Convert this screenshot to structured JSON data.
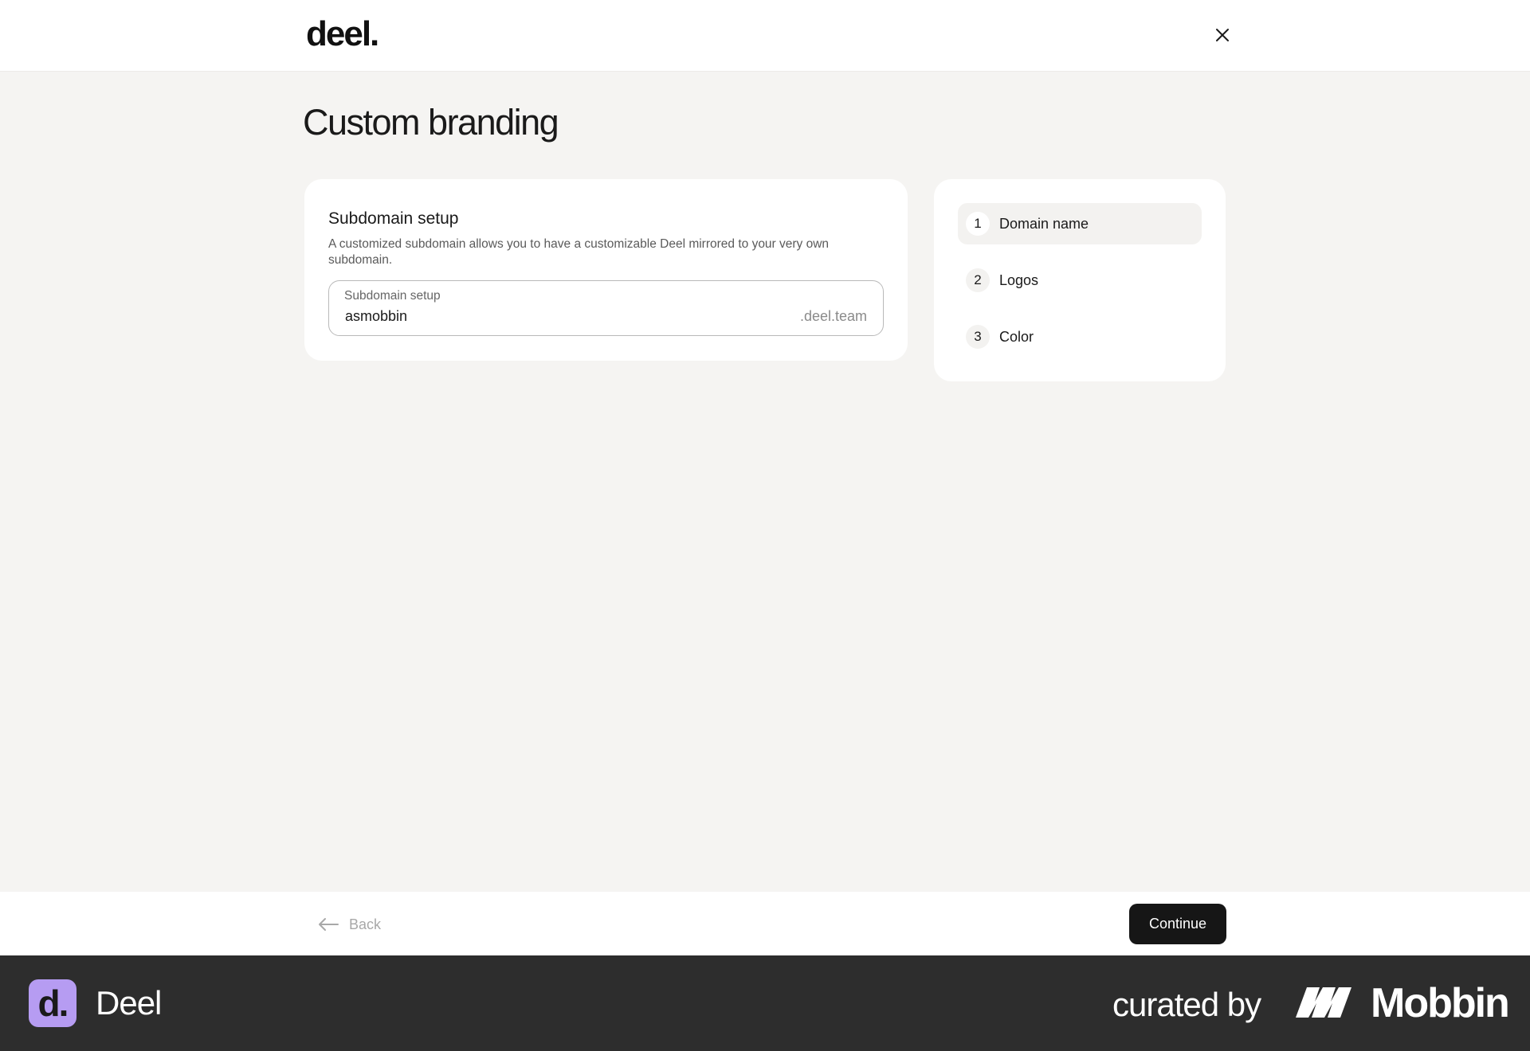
{
  "header": {
    "logo_text": "deel.",
    "close_icon": "close-icon"
  },
  "page": {
    "title": "Custom branding"
  },
  "subdomain_card": {
    "heading": "Subdomain setup",
    "description": "A customized subdomain allows you to have a customizable Deel mirrored to your very own subdomain.",
    "field": {
      "label": "Subdomain setup",
      "value": "asmobbin",
      "suffix": ".deel.team"
    }
  },
  "steps": [
    {
      "number": "1",
      "label": "Domain name",
      "active": true
    },
    {
      "number": "2",
      "label": "Logos",
      "active": false
    },
    {
      "number": "3",
      "label": "Color",
      "active": false
    }
  ],
  "footer_nav": {
    "back_label": "Back",
    "back_icon": "arrow-left-icon",
    "continue_label": "Continue"
  },
  "attribution": {
    "app_icon_text": "d.",
    "app_name": "Deel",
    "curated_by": "curated by",
    "brand_name": "Mobbin",
    "icon_bg_color": "#b69cf2"
  }
}
